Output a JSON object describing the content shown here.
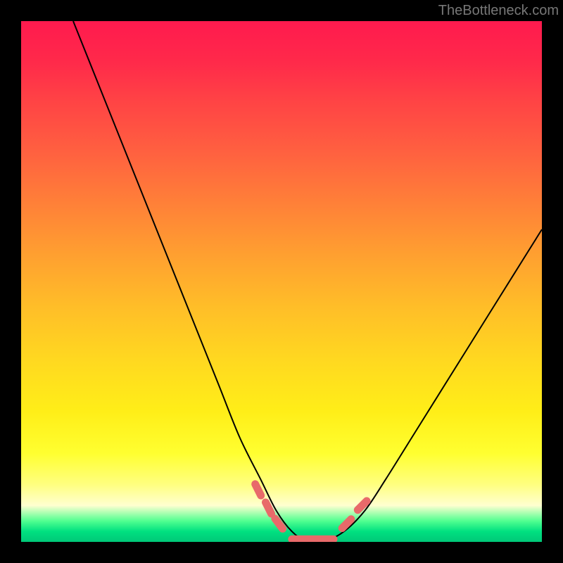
{
  "watermark": "TheBottleneck.com",
  "colors": {
    "frame": "#000000",
    "curve": "#000000",
    "markers": "#e86a6a",
    "gradient_top": "#ff1a4e",
    "gradient_bottom": "#00c878"
  },
  "chart_data": {
    "type": "line",
    "title": "",
    "xlabel": "",
    "ylabel": "",
    "xlim": [
      0,
      100
    ],
    "ylim": [
      0,
      100
    ],
    "series": [
      {
        "name": "bottleneck-curve",
        "x": [
          10,
          14,
          18,
          22,
          26,
          30,
          34,
          38,
          42,
          46,
          49,
          52,
          55,
          58,
          62,
          66,
          70,
          75,
          80,
          85,
          90,
          95,
          100
        ],
        "y": [
          100,
          90,
          80,
          70,
          60,
          50,
          40,
          30,
          20,
          12,
          6,
          2,
          0,
          0,
          2,
          6,
          12,
          20,
          28,
          36,
          44,
          52,
          60
        ]
      }
    ],
    "markers": [
      {
        "x": 45.5,
        "y": 10
      },
      {
        "x": 47.5,
        "y": 6.5
      },
      {
        "x": 49.5,
        "y": 3.5
      },
      {
        "x": 62.5,
        "y": 3.5
      },
      {
        "x": 65.5,
        "y": 7
      }
    ],
    "valley_bar": {
      "x0": 52,
      "x1": 60,
      "y": 0.5
    },
    "annotations": []
  }
}
